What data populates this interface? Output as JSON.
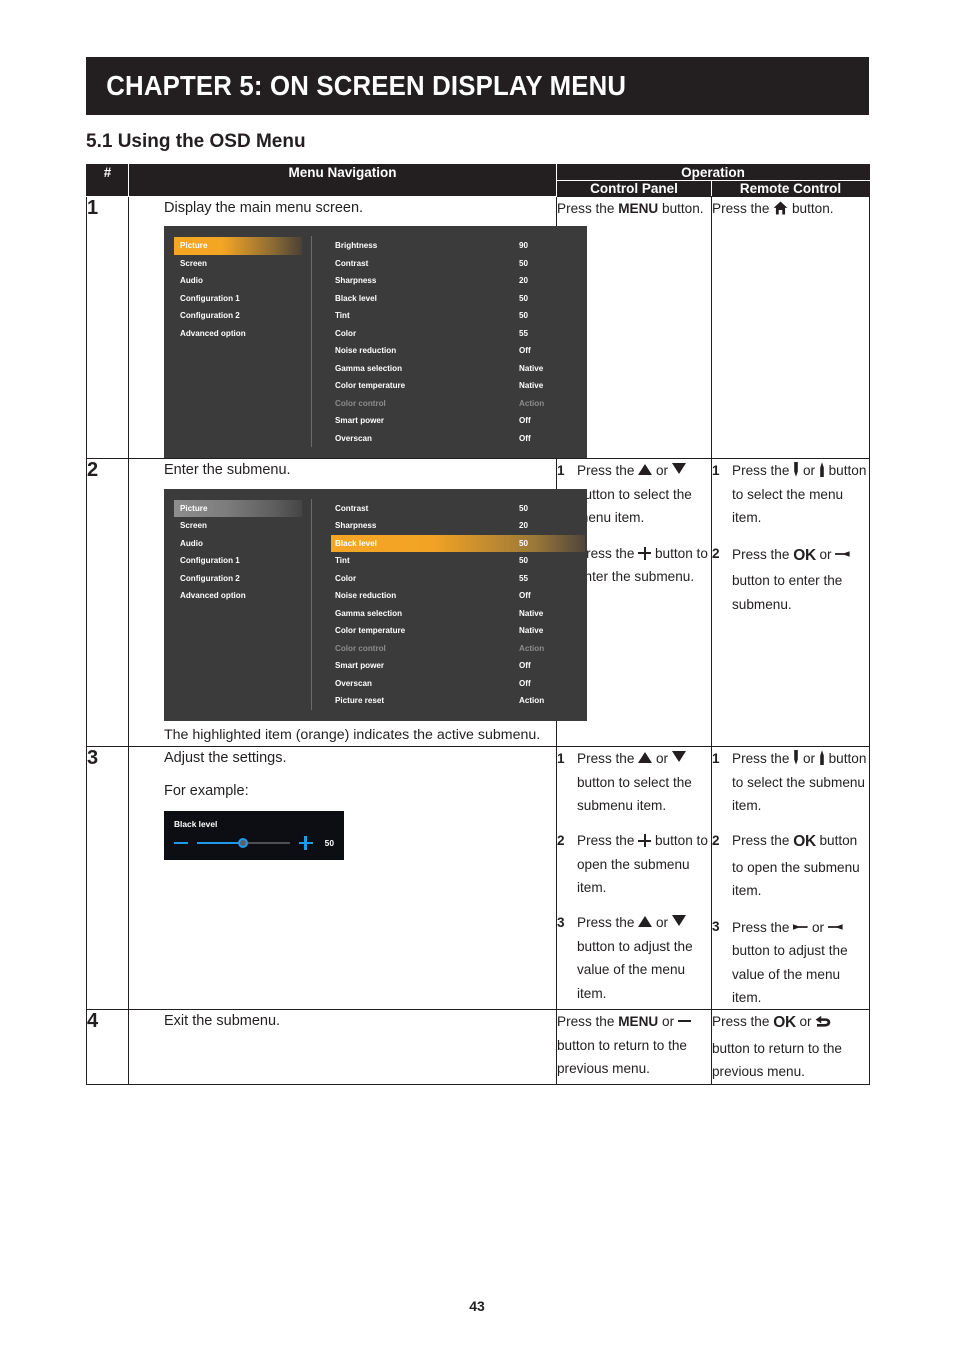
{
  "chapter": {
    "title": "CHAPTER 5: ON SCREEN DISPLAY MENU"
  },
  "section": {
    "heading": "5.1 Using the OSD Menu"
  },
  "table": {
    "headers": {
      "num": "#",
      "menu_navigation": "Menu Navigation",
      "operation": "Operation",
      "control_panel": "Control Panel",
      "remote_control": "Remote Control"
    },
    "rows": [
      {
        "num": "1",
        "nav_text": "Display the main menu screen.",
        "control_panel": {
          "type": "plain",
          "parts": [
            "Press the ",
            "MENU",
            " button."
          ]
        },
        "remote_control": {
          "type": "plain",
          "parts": [
            "Press the ",
            "home-icon",
            " button."
          ]
        }
      },
      {
        "num": "2",
        "nav_text": "Enter the submenu.",
        "nav_note": "The highlighted item (orange) indicates the active submenu.",
        "control_panel": {
          "type": "steps",
          "steps": [
            {
              "num": "1",
              "text_a": "Press the ",
              "icon_a": "up-triangle-icon",
              "text_b": " or ",
              "icon_b": "down-triangle-icon",
              "text_c": " button to select the menu item."
            },
            {
              "num": "2",
              "text_a": "Press the ",
              "icon_a": "plus-icon",
              "text_c": " button to enter the submenu."
            }
          ]
        },
        "remote_control": {
          "type": "steps",
          "steps": [
            {
              "num": "1",
              "text_a": "Press the ",
              "icon_a": "remote-down-icon",
              "text_b": " or ",
              "icon_b": "remote-up-icon",
              "text_c": " button to select the menu item."
            },
            {
              "num": "2",
              "text_a": "Press the ",
              "icon_a": "ok-icon",
              "text_b": " or ",
              "icon_b": "remote-right-icon",
              "text_c": " button to enter the submenu."
            }
          ]
        }
      },
      {
        "num": "3",
        "nav_text": "Adjust the settings.",
        "nav_sub": "For example:",
        "control_panel": {
          "type": "steps",
          "steps": [
            {
              "num": "1",
              "text_a": "Press the ",
              "icon_a": "up-triangle-icon",
              "text_b": " or ",
              "icon_b": "down-triangle-icon",
              "text_c": " button to select the submenu item."
            },
            {
              "num": "2",
              "text_a": "Press the ",
              "icon_a": "plus-icon",
              "text_c": " button to open the submenu item."
            },
            {
              "num": "3",
              "text_a": "Press the ",
              "icon_a": "up-triangle-icon",
              "text_b": " or ",
              "icon_b": "down-triangle-icon",
              "text_c": " button to adjust the value of the menu item."
            }
          ]
        },
        "remote_control": {
          "type": "steps",
          "steps": [
            {
              "num": "1",
              "text_a": "Press the ",
              "icon_a": "remote-down-icon",
              "text_b": " or ",
              "icon_b": "remote-up-icon",
              "text_c": " button to select the submenu item."
            },
            {
              "num": "2",
              "text_a": "Press the ",
              "icon_a": "ok-icon",
              "text_c": " button to open the submenu item."
            },
            {
              "num": "3",
              "text_a": "Press the ",
              "icon_a": "remote-left-icon",
              "text_b": " or ",
              "icon_b": "remote-right-icon",
              "text_c": " button to adjust the value of the menu item."
            }
          ]
        }
      },
      {
        "num": "4",
        "nav_text": "Exit the submenu.",
        "control_panel": {
          "type": "plain",
          "parts": [
            "Press the ",
            "MENU",
            " or ",
            "minus-icon",
            " button to return to the previous menu."
          ]
        },
        "remote_control": {
          "type": "plain",
          "parts": [
            "Press the ",
            "ok-icon",
            " or ",
            "back-icon",
            " button to return to the previous menu."
          ]
        }
      }
    ]
  },
  "osd_menu_1": {
    "categories": [
      {
        "label": "Picture",
        "highlight": "orange"
      },
      {
        "label": "Screen",
        "highlight": "none"
      },
      {
        "label": "Audio",
        "highlight": "none"
      },
      {
        "label": "Configuration 1",
        "highlight": "none"
      },
      {
        "label": "Configuration 2",
        "highlight": "none"
      },
      {
        "label": "Advanced option",
        "highlight": "none"
      }
    ],
    "items": [
      {
        "label": "Brightness",
        "value": "90",
        "state": "normal"
      },
      {
        "label": "Contrast",
        "value": "50",
        "state": "normal"
      },
      {
        "label": "Sharpness",
        "value": "20",
        "state": "normal"
      },
      {
        "label": "Black level",
        "value": "50",
        "state": "normal"
      },
      {
        "label": "Tint",
        "value": "50",
        "state": "normal"
      },
      {
        "label": "Color",
        "value": "55",
        "state": "normal"
      },
      {
        "label": "Noise reduction",
        "value": "Off",
        "state": "normal"
      },
      {
        "label": "Gamma selection",
        "value": "Native",
        "state": "normal"
      },
      {
        "label": "Color temperature",
        "value": "Native",
        "state": "normal"
      },
      {
        "label": "Color control",
        "value": "Action",
        "state": "dim"
      },
      {
        "label": "Smart power",
        "value": "Off",
        "state": "normal"
      },
      {
        "label": "Overscan",
        "value": "Off",
        "state": "normal"
      }
    ]
  },
  "osd_menu_2": {
    "categories": [
      {
        "label": "Picture",
        "highlight": "gray"
      },
      {
        "label": "Screen",
        "highlight": "none"
      },
      {
        "label": "Audio",
        "highlight": "none"
      },
      {
        "label": "Configuration 1",
        "highlight": "none"
      },
      {
        "label": "Configuration 2",
        "highlight": "none"
      },
      {
        "label": "Advanced option",
        "highlight": "none"
      }
    ],
    "items": [
      {
        "label": "Contrast",
        "value": "50",
        "state": "normal"
      },
      {
        "label": "Sharpness",
        "value": "20",
        "state": "normal"
      },
      {
        "label": "Black level",
        "value": "50",
        "state": "highlight"
      },
      {
        "label": "Tint",
        "value": "50",
        "state": "normal"
      },
      {
        "label": "Color",
        "value": "55",
        "state": "normal"
      },
      {
        "label": "Noise reduction",
        "value": "Off",
        "state": "normal"
      },
      {
        "label": "Gamma selection",
        "value": "Native",
        "state": "normal"
      },
      {
        "label": "Color temperature",
        "value": "Native",
        "state": "normal"
      },
      {
        "label": "Color control",
        "value": "Action",
        "state": "dim"
      },
      {
        "label": "Smart power",
        "value": "Off",
        "state": "normal"
      },
      {
        "label": "Overscan",
        "value": "Off",
        "state": "normal"
      },
      {
        "label": "Picture reset",
        "value": "Action",
        "state": "normal"
      }
    ]
  },
  "slider": {
    "title": "Black level",
    "value": "50",
    "percent": 50,
    "accent_color": "#1e9ae8"
  },
  "footer": {
    "page_number": "43"
  },
  "colors": {
    "banner_bg": "#231f20",
    "osd_bg": "#3b3b3b",
    "osd_highlight_orange": "#f5a623",
    "osd_highlight_gray": "#8e8e8e",
    "slider_bg": "#0d0d14"
  }
}
